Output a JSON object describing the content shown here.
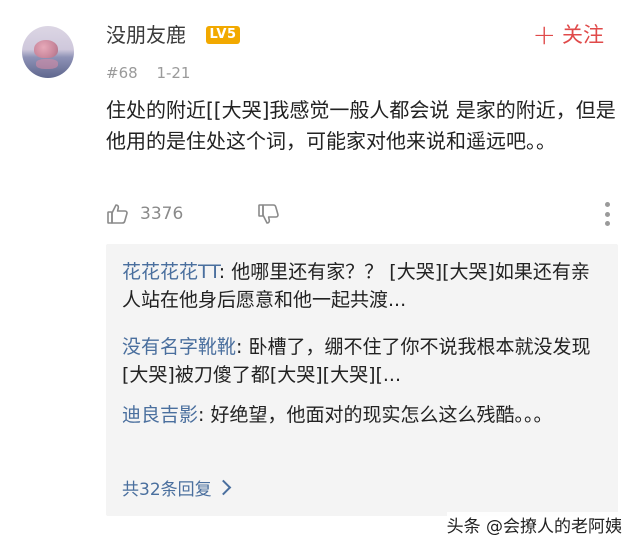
{
  "comment": {
    "username": "没朋友鹿",
    "level_badge": "LV5",
    "follow_label": "关注",
    "floor": "#68",
    "date": "1-21",
    "text": "住处的附近[[大哭]我感觉一般人都会说 是家的附近，但是他用的是住处这个词，可能家对他来说和遥远吧。。",
    "like_count": "3376"
  },
  "replies": [
    {
      "name": "花花花花TT",
      "text": ": 他哪里还有家？？ [大哭][大哭]如果还有亲人站在他身后愿意和他一起共渡..."
    },
    {
      "name": "没有名字靴靴",
      "text": ": 卧槽了，绷不住了你不说我根本就没发现[大哭]被刀傻了都[大哭][大哭][..."
    },
    {
      "name": "迪良吉影",
      "text": ": 好绝望，他面对的现实怎么这么残酷。。。"
    }
  ],
  "more_replies_label": "共32条回复",
  "watermark": "头条 @会撩人的老阿姨",
  "colors": {
    "accent_red": "#e04a4a",
    "link_blue": "#4a6f9e",
    "level_gold": "#f2a900"
  }
}
